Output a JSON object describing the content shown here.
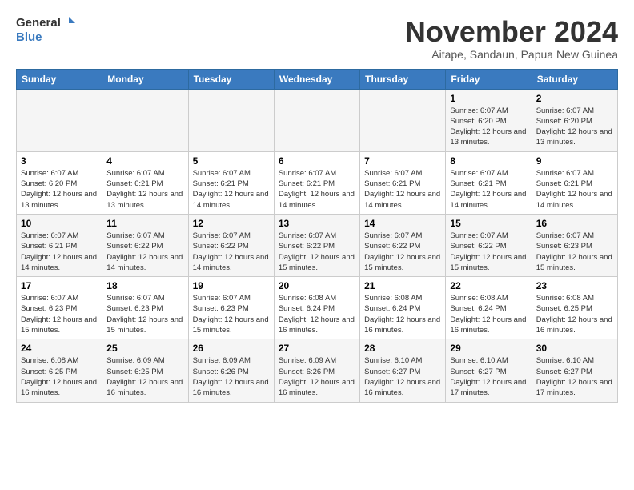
{
  "header": {
    "logo_line1": "General",
    "logo_line2": "Blue",
    "month": "November 2024",
    "location": "Aitape, Sandaun, Papua New Guinea"
  },
  "days_of_week": [
    "Sunday",
    "Monday",
    "Tuesday",
    "Wednesday",
    "Thursday",
    "Friday",
    "Saturday"
  ],
  "weeks": [
    [
      {
        "day": "",
        "text": ""
      },
      {
        "day": "",
        "text": ""
      },
      {
        "day": "",
        "text": ""
      },
      {
        "day": "",
        "text": ""
      },
      {
        "day": "",
        "text": ""
      },
      {
        "day": "1",
        "text": "Sunrise: 6:07 AM\nSunset: 6:20 PM\nDaylight: 12 hours and 13 minutes."
      },
      {
        "day": "2",
        "text": "Sunrise: 6:07 AM\nSunset: 6:20 PM\nDaylight: 12 hours and 13 minutes."
      }
    ],
    [
      {
        "day": "3",
        "text": "Sunrise: 6:07 AM\nSunset: 6:20 PM\nDaylight: 12 hours and 13 minutes."
      },
      {
        "day": "4",
        "text": "Sunrise: 6:07 AM\nSunset: 6:21 PM\nDaylight: 12 hours and 13 minutes."
      },
      {
        "day": "5",
        "text": "Sunrise: 6:07 AM\nSunset: 6:21 PM\nDaylight: 12 hours and 14 minutes."
      },
      {
        "day": "6",
        "text": "Sunrise: 6:07 AM\nSunset: 6:21 PM\nDaylight: 12 hours and 14 minutes."
      },
      {
        "day": "7",
        "text": "Sunrise: 6:07 AM\nSunset: 6:21 PM\nDaylight: 12 hours and 14 minutes."
      },
      {
        "day": "8",
        "text": "Sunrise: 6:07 AM\nSunset: 6:21 PM\nDaylight: 12 hours and 14 minutes."
      },
      {
        "day": "9",
        "text": "Sunrise: 6:07 AM\nSunset: 6:21 PM\nDaylight: 12 hours and 14 minutes."
      }
    ],
    [
      {
        "day": "10",
        "text": "Sunrise: 6:07 AM\nSunset: 6:21 PM\nDaylight: 12 hours and 14 minutes."
      },
      {
        "day": "11",
        "text": "Sunrise: 6:07 AM\nSunset: 6:22 PM\nDaylight: 12 hours and 14 minutes."
      },
      {
        "day": "12",
        "text": "Sunrise: 6:07 AM\nSunset: 6:22 PM\nDaylight: 12 hours and 14 minutes."
      },
      {
        "day": "13",
        "text": "Sunrise: 6:07 AM\nSunset: 6:22 PM\nDaylight: 12 hours and 15 minutes."
      },
      {
        "day": "14",
        "text": "Sunrise: 6:07 AM\nSunset: 6:22 PM\nDaylight: 12 hours and 15 minutes."
      },
      {
        "day": "15",
        "text": "Sunrise: 6:07 AM\nSunset: 6:22 PM\nDaylight: 12 hours and 15 minutes."
      },
      {
        "day": "16",
        "text": "Sunrise: 6:07 AM\nSunset: 6:23 PM\nDaylight: 12 hours and 15 minutes."
      }
    ],
    [
      {
        "day": "17",
        "text": "Sunrise: 6:07 AM\nSunset: 6:23 PM\nDaylight: 12 hours and 15 minutes."
      },
      {
        "day": "18",
        "text": "Sunrise: 6:07 AM\nSunset: 6:23 PM\nDaylight: 12 hours and 15 minutes."
      },
      {
        "day": "19",
        "text": "Sunrise: 6:07 AM\nSunset: 6:23 PM\nDaylight: 12 hours and 15 minutes."
      },
      {
        "day": "20",
        "text": "Sunrise: 6:08 AM\nSunset: 6:24 PM\nDaylight: 12 hours and 16 minutes."
      },
      {
        "day": "21",
        "text": "Sunrise: 6:08 AM\nSunset: 6:24 PM\nDaylight: 12 hours and 16 minutes."
      },
      {
        "day": "22",
        "text": "Sunrise: 6:08 AM\nSunset: 6:24 PM\nDaylight: 12 hours and 16 minutes."
      },
      {
        "day": "23",
        "text": "Sunrise: 6:08 AM\nSunset: 6:25 PM\nDaylight: 12 hours and 16 minutes."
      }
    ],
    [
      {
        "day": "24",
        "text": "Sunrise: 6:08 AM\nSunset: 6:25 PM\nDaylight: 12 hours and 16 minutes."
      },
      {
        "day": "25",
        "text": "Sunrise: 6:09 AM\nSunset: 6:25 PM\nDaylight: 12 hours and 16 minutes."
      },
      {
        "day": "26",
        "text": "Sunrise: 6:09 AM\nSunset: 6:26 PM\nDaylight: 12 hours and 16 minutes."
      },
      {
        "day": "27",
        "text": "Sunrise: 6:09 AM\nSunset: 6:26 PM\nDaylight: 12 hours and 16 minutes."
      },
      {
        "day": "28",
        "text": "Sunrise: 6:10 AM\nSunset: 6:27 PM\nDaylight: 12 hours and 16 minutes."
      },
      {
        "day": "29",
        "text": "Sunrise: 6:10 AM\nSunset: 6:27 PM\nDaylight: 12 hours and 17 minutes."
      },
      {
        "day": "30",
        "text": "Sunrise: 6:10 AM\nSunset: 6:27 PM\nDaylight: 12 hours and 17 minutes."
      }
    ]
  ]
}
